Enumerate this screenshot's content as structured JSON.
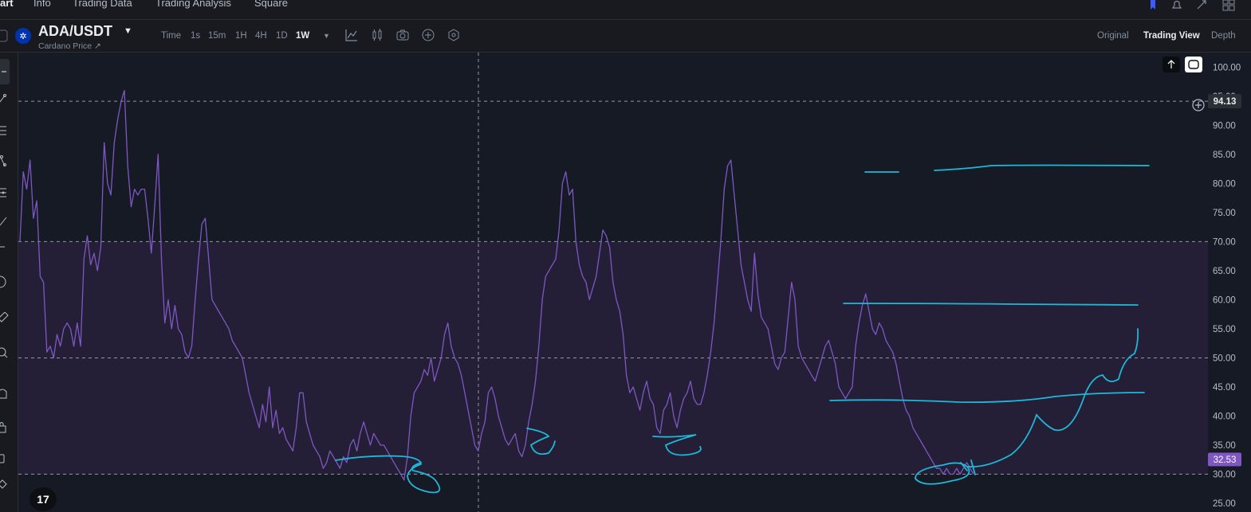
{
  "top_nav": {
    "tabs": [
      {
        "label": "art",
        "active": true
      },
      {
        "label": "Info",
        "active": false
      },
      {
        "label": "Trading Data",
        "active": false
      },
      {
        "label": "Trading Analysis",
        "active": false
      },
      {
        "label": "Square",
        "active": false
      }
    ],
    "icons": [
      "bookmark-icon",
      "bell-icon",
      "expand-icon",
      "grid-layout-icon"
    ]
  },
  "header": {
    "pair": "ADA/USDT",
    "subtitle": "Cardano Price ↗",
    "coin_icon": "cardano-icon"
  },
  "timeframes": {
    "items": [
      "Time",
      "1s",
      "15m",
      "1H",
      "4H",
      "1D",
      "1W"
    ],
    "active": "1W"
  },
  "chart_tools": [
    "chart-type-icon",
    "candles-icon",
    "camera-icon",
    "plus-circle-icon",
    "settings-hex-icon"
  ],
  "views": {
    "items": [
      "Original",
      "Trading View",
      "Depth"
    ],
    "active": "Trading View"
  },
  "colors": {
    "background": "#161a25",
    "rsi_line": "#7e57c2",
    "band_fill": "#241f36",
    "drawing": "#1fb8d9",
    "current_badge": "#7e57c2"
  },
  "chart_data": {
    "type": "line",
    "series": [
      {
        "values": [
          70,
          82,
          79,
          84,
          74,
          77,
          64,
          63,
          51,
          52,
          50,
          54,
          52,
          55,
          56,
          55,
          52,
          56,
          52,
          67,
          71,
          66,
          68,
          65,
          69,
          87,
          80,
          78,
          87,
          91,
          94,
          96,
          83,
          76,
          79,
          78,
          79,
          79,
          74,
          68,
          76,
          85,
          67,
          56,
          60,
          55,
          59,
          55,
          54,
          51,
          50,
          52,
          60,
          67,
          73,
          74,
          67,
          60,
          59,
          58,
          57,
          56,
          55,
          53,
          52,
          51,
          50,
          47,
          44,
          42,
          40,
          38,
          42,
          39,
          45,
          38,
          41,
          37,
          38,
          36,
          35,
          34,
          38,
          44,
          44,
          39,
          37,
          35,
          34,
          33,
          31,
          32,
          34,
          33,
          32,
          31,
          33,
          32,
          35,
          36,
          34,
          37,
          39,
          37,
          35,
          37,
          36,
          35,
          35,
          34,
          33,
          32,
          31,
          30,
          29,
          33,
          40,
          44,
          45,
          46,
          48,
          47,
          50,
          46,
          48,
          50,
          54,
          56,
          52,
          50,
          49,
          47,
          44,
          41,
          38,
          35,
          34,
          37,
          39,
          44,
          45,
          43,
          40,
          38,
          36,
          35,
          36,
          37,
          34,
          33,
          35,
          39,
          42,
          46,
          52,
          60,
          64,
          65,
          66,
          67,
          72,
          80,
          82,
          78,
          79,
          70,
          66,
          64,
          63,
          60,
          62,
          64,
          68,
          72,
          71,
          69,
          63,
          60,
          58,
          54,
          47,
          44,
          45,
          43,
          41,
          44,
          46,
          43,
          42,
          38,
          37,
          41,
          42,
          44,
          40,
          38,
          41,
          43,
          44,
          46,
          43,
          42,
          42,
          44,
          47,
          51,
          56,
          63,
          70,
          79,
          83,
          84,
          78,
          72,
          66,
          63,
          60,
          58,
          68,
          61,
          57,
          56,
          55,
          52,
          49,
          48,
          50,
          51,
          57,
          63,
          60,
          52,
          50,
          49,
          48,
          47,
          46,
          48,
          50,
          52,
          53,
          51,
          49,
          45,
          44,
          43,
          44,
          45,
          52,
          56,
          59,
          61,
          58,
          55,
          54,
          56,
          55,
          53,
          52,
          51,
          49,
          46,
          43,
          41,
          40,
          38,
          37,
          36,
          35,
          34,
          33,
          32,
          31,
          31,
          30,
          31,
          30,
          30,
          31,
          30,
          31,
          32,
          31,
          30
        ]
      }
    ],
    "y_ticks": [
      "100.00",
      "95.00",
      "90.00",
      "85.00",
      "80.00",
      "75.00",
      "70.00",
      "65.00",
      "60.00",
      "55.00",
      "50.00",
      "45.00",
      "40.00",
      "35.00",
      "30.00",
      "25.00"
    ],
    "ylim": [
      23.5,
      102.5
    ],
    "crosshair_value": "94.13",
    "current_value": "32.53",
    "reference_levels": [
      30,
      50,
      70
    ],
    "band": [
      30,
      70
    ]
  }
}
